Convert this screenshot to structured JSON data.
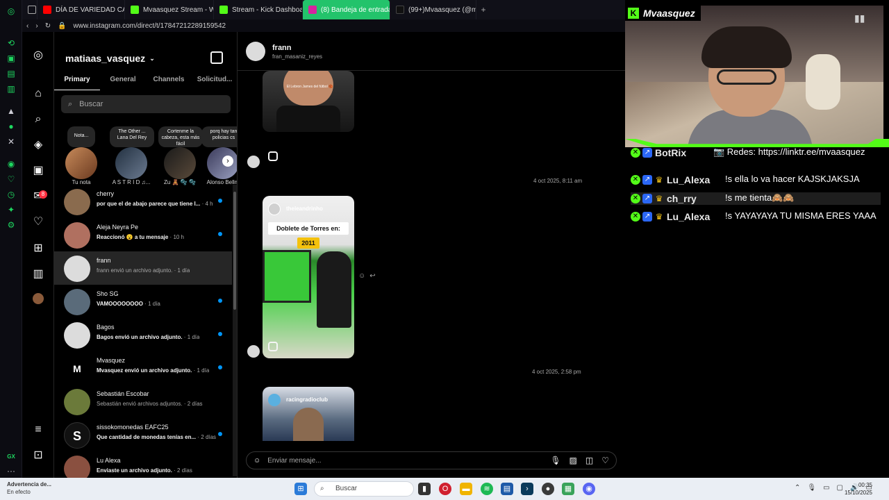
{
  "browser": {
    "tabs": [
      {
        "label": "DÍA DE VARIEDAD CARA...",
        "color": "#ff0000"
      },
      {
        "label": "Mvaasquez Stream - Wat",
        "color": "#53fc18"
      },
      {
        "label": "Stream - Kick Dashboard",
        "color": "#53fc18"
      },
      {
        "label": "(8) Bandeja de entrada •",
        "color": "#d6249f"
      },
      {
        "label": "(99+)Mvaasquez (@mvaaq",
        "color": "#111111"
      }
    ],
    "url": "www.instagram.com/direct/t/17847212289159542",
    "new_tab": "+"
  },
  "gx_strip": {
    "gx_label": "GX",
    "more": "···"
  },
  "ig_rail": {
    "notifications_badge": "8",
    "icons": [
      "instagram-logo-icon",
      "home-icon",
      "search-icon",
      "explore-icon",
      "reels-icon",
      "messages-icon",
      "heart-icon",
      "create-icon",
      "dashboard-icon",
      "profile-avatar",
      "menu-icon",
      "more-icon"
    ]
  },
  "inbox": {
    "username": "matiaas_vasquez",
    "tabs": [
      "Primary",
      "General",
      "Channels",
      "Solicitud..."
    ],
    "search_placeholder": "Buscar",
    "notes": [
      {
        "bubble": "Nota...",
        "name": "Tu nota"
      },
      {
        "bubble": "The Other ... Lana Del Rey",
        "name": "A S T R I D ♫..."
      },
      {
        "bubble": "Cortenme la cabeza, esta más fácil",
        "name": "Zu 🧸 🫧 🫧"
      },
      {
        "bubble": "porq hay tan policias cs",
        "name": "Alonso Bellm"
      }
    ],
    "conversations": [
      {
        "name": "cherry",
        "preview": "por que el de abajo parece que tiene l...",
        "time": " · 4 h",
        "unread": true,
        "dim": false,
        "active": false,
        "avatar": "#8a6b4e"
      },
      {
        "name": "Aleja Neyra Pe",
        "preview": "Reaccionó 😮 a tu mensaje",
        "time": " · 10 h",
        "unread": true,
        "dim": false,
        "active": false,
        "avatar": "#b07060"
      },
      {
        "name": "frann",
        "preview": "frann envió un archivo adjunto.",
        "time": " · 1 día",
        "unread": false,
        "dim": true,
        "active": true,
        "avatar": "#dcdcdc"
      },
      {
        "name": "Sho SG",
        "preview": "VAMOOOOOOOO",
        "time": " · 1 día",
        "unread": true,
        "dim": false,
        "active": false,
        "avatar": "#5a6b7a"
      },
      {
        "name": "Bagos",
        "preview": "Bagos envió un archivo adjunto.",
        "time": " · 1 día",
        "unread": true,
        "dim": false,
        "active": false,
        "avatar": "#dcdcdc"
      },
      {
        "name": "Mvasquez",
        "preview": "Mvasquez envió un archivo adjunto.",
        "time": " · 1 día",
        "unread": true,
        "dim": false,
        "active": false,
        "avatar": "#000000"
      },
      {
        "name": "Sebastián Escobar",
        "preview": "Sebastián envió archivos adjuntos.",
        "time": " · 2 días",
        "unread": false,
        "dim": true,
        "active": false,
        "avatar": "#6b7a3a"
      },
      {
        "name": "sissokomonedas EAFC25",
        "preview": "Que cantidad de monedas tenías en...",
        "time": " · 2 días",
        "unread": true,
        "dim": false,
        "active": false,
        "avatar": "#111111"
      },
      {
        "name": "Lu Alexa",
        "preview": "Enviaste un archivo adjunto.",
        "time": " · 2 días",
        "unread": false,
        "dim": false,
        "active": false,
        "avatar": "#8a5040"
      }
    ],
    "sisso_initial": "S",
    "mvasquez_initial": "M"
  },
  "chat": {
    "name": "frann",
    "username": "fran_masaniz_reyes",
    "reel1_caption": "El Lebron James del fútbol 🏀",
    "stamp1": "4 oct 2025, 8:11 am",
    "reel2_user": "theleandrinho",
    "reel2_title": "Doblete de Torres en:",
    "reel2_year": "2011",
    "stamp2": "4 oct 2025, 2:58 pm",
    "reel3_user": "racingradioclub",
    "composer_placeholder": "Enviar mensaje..."
  },
  "stream": {
    "streamer": "Mvaasquez",
    "chat": [
      {
        "user": "BotRix",
        "text": "📷 Redes: https://linktr.ee/mvaasquez",
        "hl": false,
        "badges": [
          "mod",
          "vip"
        ],
        "user_color": "#e8e8e8"
      },
      {
        "user": "Lu_Alexa",
        "text": "!s ella lo va hacer KAJSKJAKSJA",
        "hl": false,
        "badges": [
          "mod",
          "vip",
          "crown"
        ],
        "user_color": "#e8e8e8"
      },
      {
        "user": "ch_rry",
        "text": "!s me tienta🙈🙈",
        "hl": true,
        "badges": [
          "mod",
          "vip",
          "crown"
        ],
        "user_color": "#e8e8e8"
      },
      {
        "user": "Lu_Alexa",
        "text": "!s YAYAYAYA TU MISMA ERES YAAA",
        "hl": false,
        "badges": [
          "mod",
          "vip",
          "crown"
        ],
        "user_color": "#e8e8e8"
      }
    ]
  },
  "taskbar": {
    "weather_title": "Advertencia de...",
    "weather_sub": "En efecto",
    "search_placeholder": "Buscar",
    "time": "00:35",
    "date": "15/10/2025"
  }
}
